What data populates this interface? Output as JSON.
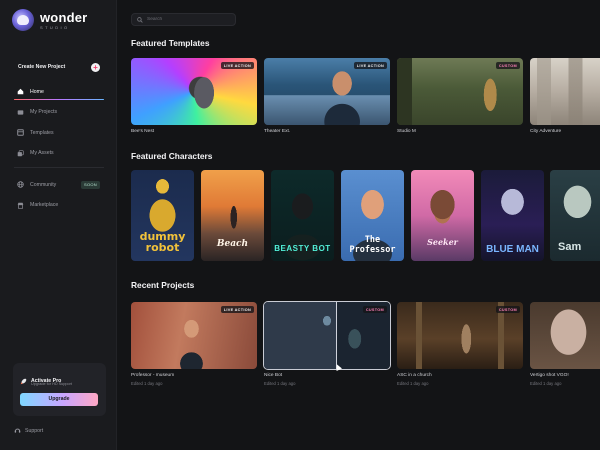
{
  "app": {
    "logo_word": "wonder",
    "logo_sub": "STUDIO"
  },
  "sidebar": {
    "create_label": "Create New Project",
    "items": [
      {
        "label": "Home",
        "icon": "home-icon",
        "active": true
      },
      {
        "label": "My Projects",
        "icon": "projects-icon"
      },
      {
        "label": "Templates",
        "icon": "templates-icon"
      },
      {
        "label": "My Assets",
        "icon": "assets-icon"
      }
    ],
    "community": {
      "label": "Community",
      "badge": "SOON",
      "icon": "globe-icon"
    },
    "marketplace": {
      "label": "Marketplace",
      "icon": "store-icon"
    },
    "pro": {
      "title": "Activate Pro",
      "subtitle": "Upgrade for HD Support",
      "button": "Upgrade",
      "icon": "rocket-icon"
    },
    "support_label": "Support",
    "colors": {
      "accent_gradient": [
        "#7fd7ff",
        "#c8a6ff",
        "#ffa7c4"
      ],
      "active_underline": [
        "#ff6a6a",
        "#b978ff",
        "#6ab6ff"
      ]
    }
  },
  "search": {
    "placeholder": "Search"
  },
  "sections": {
    "templates_title": "Featured Templates",
    "characters_title": "Featured Characters",
    "recent_title": "Recent Projects"
  },
  "templates": [
    {
      "name": "Bee's Nest",
      "tag": "LIVE ACTION"
    },
    {
      "name": "Theater Ext.",
      "tag": "LIVE ACTION"
    },
    {
      "name": "Studio M",
      "tag": "CUSTOM"
    },
    {
      "name": "City Adventure",
      "tag": ""
    }
  ],
  "characters": [
    {
      "label": "dummy robot"
    },
    {
      "label": "Beach"
    },
    {
      "label": "BEASTY BOT"
    },
    {
      "label": "The Professor"
    },
    {
      "label": "Seeker"
    },
    {
      "label": "BLUE MAN"
    },
    {
      "label": "Sam"
    }
  ],
  "recent": [
    {
      "name": "Professor - museum",
      "edited": "Edited 1 day ago",
      "tag": "LIVE ACTION"
    },
    {
      "name": "Nice Bot",
      "edited": "Edited 1 day ago",
      "tag": "CUSTOM"
    },
    {
      "name": "ASC in a church",
      "edited": "Edited 1 day ago",
      "tag": "CUSTOM"
    },
    {
      "name": "Vertigo shot VGO!",
      "edited": "Edited 1 day ago",
      "tag": ""
    }
  ]
}
